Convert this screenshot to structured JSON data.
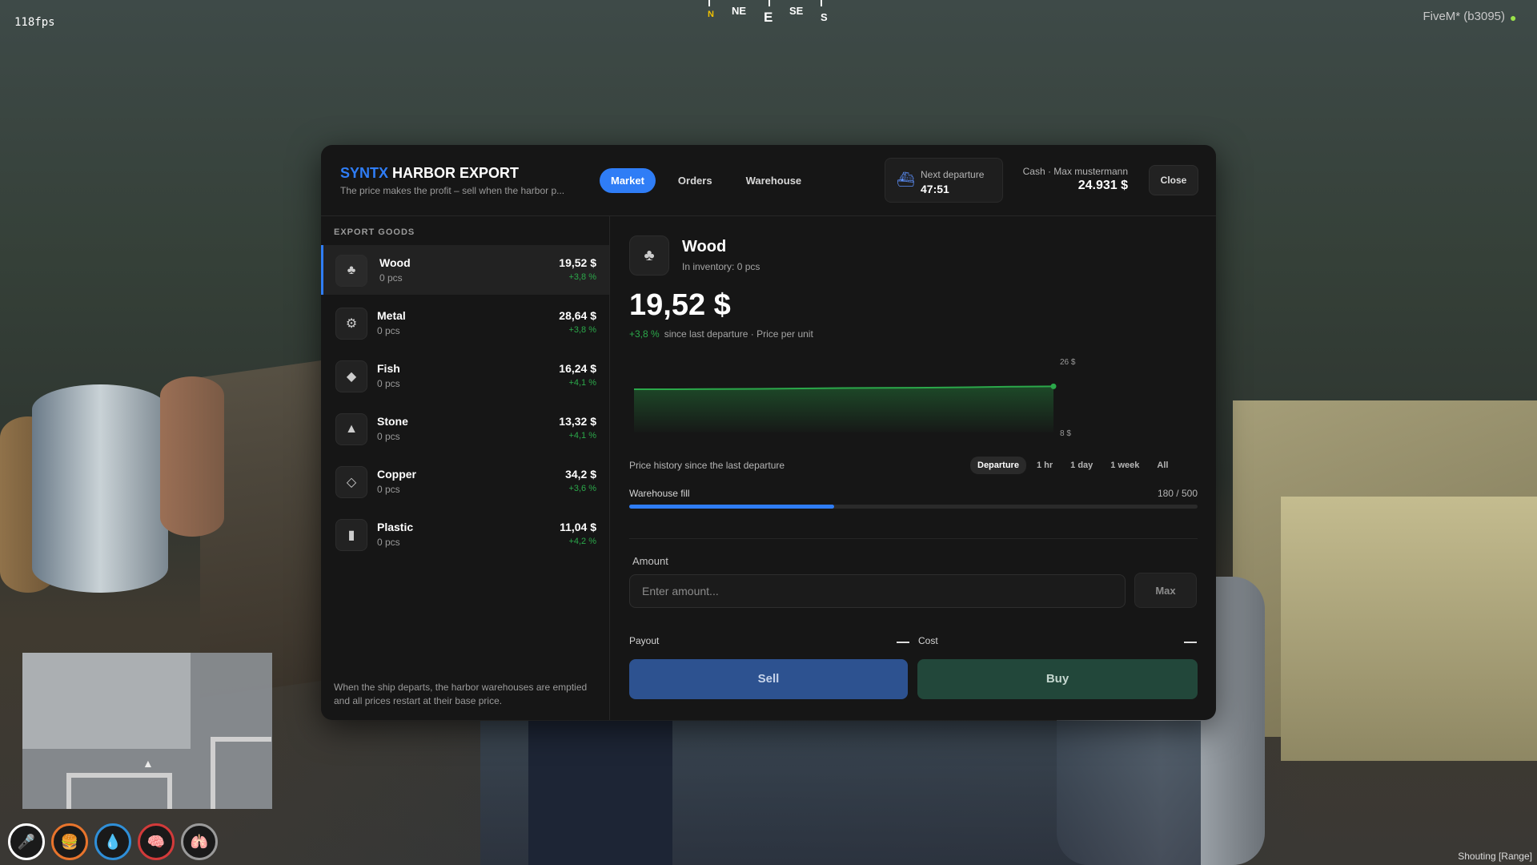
{
  "overlay": {
    "fps": "118fps",
    "compass": [
      "N",
      "NE",
      "E",
      "SE",
      "S"
    ],
    "client": "FiveM* (b3095)",
    "voice_mode": "Shouting [Range]"
  },
  "hud": {
    "icons": [
      "microphone-icon",
      "hunger-icon",
      "thirst-icon",
      "stress-icon",
      "lungs-icon"
    ],
    "colors": [
      "#ffffff",
      "#e8742c",
      "#2f8fd8",
      "#d23a3a",
      "#9a9a9a"
    ]
  },
  "header": {
    "brand_accent": "SYNTX",
    "brand_rest": "HARBOR EXPORT",
    "subtitle": "The price makes the profit – sell when the harbor p...",
    "tabs": [
      {
        "label": "Market",
        "active": true
      },
      {
        "label": "Orders",
        "active": false
      },
      {
        "label": "Warehouse",
        "active": false
      }
    ],
    "departure_label": "Next departure",
    "departure_time": "47:51",
    "cash_label": "Cash · Max mustermann",
    "cash_value": "24.931 $",
    "close_label": "Close",
    "accent": "#2f7df6"
  },
  "goods": {
    "section_title": "EXPORT GOODS",
    "items": [
      {
        "name": "Wood",
        "qty": "0 pcs",
        "price": "19,52 $",
        "change": "+3,8 %",
        "icon": "tree-icon",
        "glyph": "♣"
      },
      {
        "name": "Metal",
        "qty": "0 pcs",
        "price": "28,64 $",
        "change": "+3,8 %",
        "icon": "metal-icon",
        "glyph": "⚙"
      },
      {
        "name": "Fish",
        "qty": "0 pcs",
        "price": "16,24 $",
        "change": "+4,1 %",
        "icon": "fish-icon",
        "glyph": "◆"
      },
      {
        "name": "Stone",
        "qty": "0 pcs",
        "price": "13,32 $",
        "change": "+4,1 %",
        "icon": "stone-icon",
        "glyph": "▲"
      },
      {
        "name": "Copper",
        "qty": "0 pcs",
        "price": "34,2 $",
        "change": "+3,6 %",
        "icon": "gem-icon",
        "glyph": "◇"
      },
      {
        "name": "Plastic",
        "qty": "0 pcs",
        "price": "11,04 $",
        "change": "+4,2 %",
        "icon": "bottle-icon",
        "glyph": "▮"
      }
    ],
    "footer": "When the ship departs, the harbor warehouses are emptied and all prices restart at their base price."
  },
  "detail": {
    "name": "Wood",
    "inventory": "In inventory: 0 pcs",
    "price": "19,52 $",
    "change": "+3,8 %",
    "change_note": "since last departure · Price per unit",
    "history_label": "Price history since the last departure",
    "ranges": [
      {
        "label": "Departure",
        "active": true
      },
      {
        "label": "1 hr",
        "active": false
      },
      {
        "label": "1 day",
        "active": false
      },
      {
        "label": "1 week",
        "active": false
      },
      {
        "label": "All",
        "active": false
      }
    ],
    "warehouse_label": "Warehouse fill",
    "warehouse_value": "180 / 500",
    "warehouse_fraction": 0.36,
    "amount_label": "Amount",
    "amount_placeholder": "Enter amount...",
    "max_label": "Max",
    "payout_label": "Payout",
    "cost_label": "Cost",
    "sell_label": "Sell",
    "buy_label": "Buy"
  },
  "chart_data": {
    "type": "area",
    "x": [
      0,
      1,
      2,
      3,
      4,
      5,
      6,
      7,
      8,
      9,
      10
    ],
    "series": [
      {
        "values": [
          18.8,
          18.8,
          18.85,
          18.9,
          19.0,
          19.1,
          19.15,
          19.2,
          19.3,
          19.45,
          19.52
        ]
      }
    ],
    "ylim": [
      8,
      26
    ],
    "ytick_labels": [
      "26 $",
      "8 $"
    ],
    "color": "#2ba84a",
    "grid": false
  }
}
